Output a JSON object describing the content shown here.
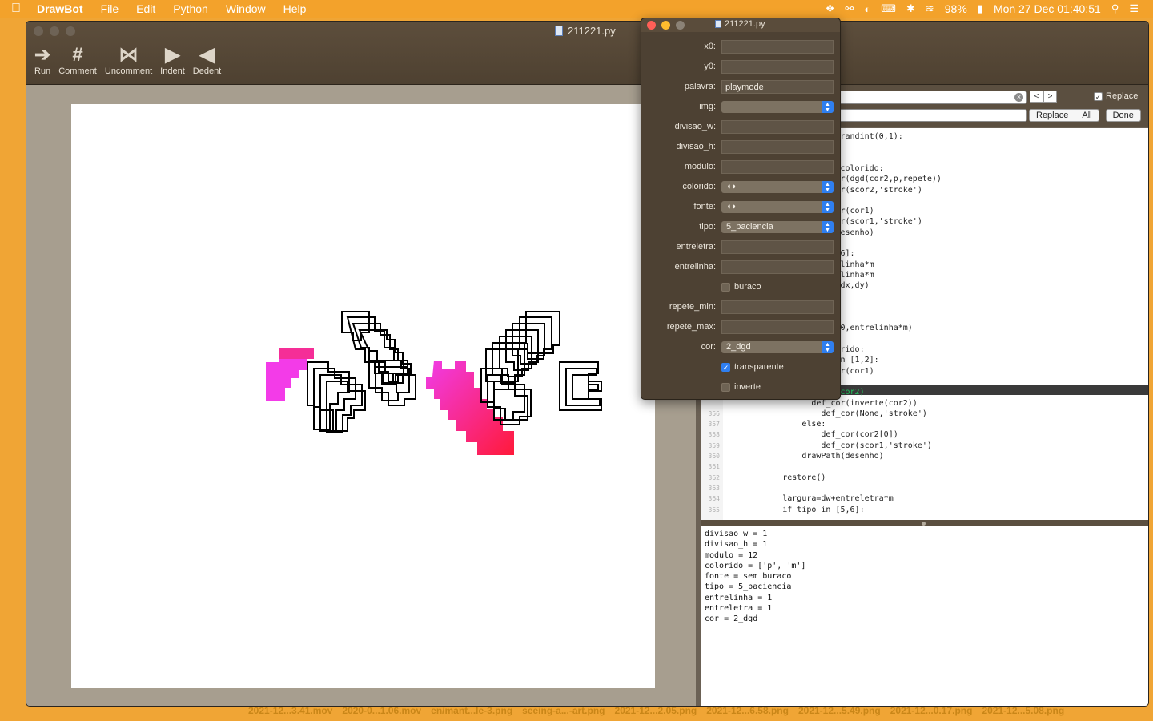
{
  "menubar": {
    "app_name": "DrawBot",
    "items": [
      "File",
      "Edit",
      "Python",
      "Window",
      "Help"
    ],
    "battery": "98%",
    "clock": "Mon 27 Dec  01:40:51"
  },
  "window": {
    "title": "211221.py",
    "toolbar": {
      "run": "Run",
      "comment": "Comment",
      "uncomment": "Uncomment",
      "indent": "Indent",
      "dedent": "Dedent"
    }
  },
  "find": {
    "replace_label": "Replace",
    "replace_checked": true,
    "replace_button": "Replace",
    "all_button": "All",
    "done_button": "Done"
  },
  "code_lines": [
    {
      "n": "",
      "t": "o and randint(0,1):"
    },
    {
      "n": "",
      "t": ""
    },
    {
      "n": "",
      "t": ""
    },
    {
      "n": "",
      "t": "ar in colorido:"
    },
    {
      "n": "",
      "t": "def_cor(dgd(cor2,p,repete))"
    },
    {
      "n": "",
      "t": "def_cor(scor2,'stroke')"
    },
    {
      "n": "",
      "t": ":"
    },
    {
      "n": "",
      "t": "def_cor(cor1)"
    },
    {
      "n": "",
      "t": "def_cor(scor1,'stroke')"
    },
    {
      "n": "",
      "t": "Path(desenho)"
    },
    {
      "n": "",
      "t": ""
    },
    {
      "n": "",
      "t": "in [5,6]:"
    },
    {
      "n": "",
      "t": "*entrelinha*m"
    },
    {
      "n": "",
      "t": "*entrelinha*m"
    },
    {
      "n": "",
      "t": "slate(dx,dy)"
    },
    {
      "n": "",
      "t": "dx"
    },
    {
      "n": "",
      "t": "dy"
    },
    {
      "n": "",
      "t": ""
    },
    {
      "n": "",
      "t": "slate(0,entrelinha*m)"
    },
    {
      "n": "",
      "t": ""
    },
    {
      "n": "",
      "t": "n colorido:"
    },
    {
      "n": "",
      "t": "tipo in [1,2]:"
    },
    {
      "n": "",
      "t": "def_cor(cor1)"
    },
    {
      "n": "",
      "t": ":"
    },
    {
      "n": "",
      "t": "print(cor2)"
    },
    {
      "n": "",
      "t": "def_cor(inverte(cor2))"
    },
    {
      "n": "356",
      "t": "                    def_cor(None,'stroke')"
    },
    {
      "n": "357",
      "t": "                else:"
    },
    {
      "n": "358",
      "t": "                    def_cor(cor2[0])"
    },
    {
      "n": "359",
      "t": "                    def_cor(scor1,'stroke')"
    },
    {
      "n": "360",
      "t": "                drawPath(desenho)"
    },
    {
      "n": "361",
      "t": ""
    },
    {
      "n": "362",
      "t": "            restore()"
    },
    {
      "n": "363",
      "t": ""
    },
    {
      "n": "364",
      "t": "            largura=dw+entreletra*m"
    },
    {
      "n": "365",
      "t": "            if tipo in [5,6]:"
    }
  ],
  "output_lines": [
    "divisao_w = 1",
    "divisao_h = 1",
    "modulo = 12",
    "colorido = ['p', 'm']",
    "fonte = sem buraco",
    "tipo = 5_paciencia",
    "entrelinha = 1",
    "entreletra = 1",
    "cor = 2_dgd"
  ],
  "panel": {
    "title": "211221.py",
    "x0": "x0:",
    "y0": "y0:",
    "palavra": "palavra:",
    "palavra_value": "playmode",
    "img": "img:",
    "divisao_w": "divisao_w:",
    "divisao_h": "divisao_h:",
    "modulo": "modulo:",
    "colorido": "colorido:",
    "colorido_value": "◖◗",
    "fonte": "fonte:",
    "fonte_value": "◖◗",
    "tipo": "tipo:",
    "tipo_value": "5_paciencia",
    "entreletra": "entreletra:",
    "entrelinha": "entrelinha:",
    "buraco": "buraco",
    "buraco_checked": false,
    "repete_min": "repete_min:",
    "repete_max": "repete_max:",
    "cor": "cor:",
    "cor_value": "2_dgd",
    "transparente": "transparente",
    "transparente_checked": true,
    "inverte": "inverte",
    "inverte_checked": false
  },
  "file_strip": [
    "2021-12...3.41.mov",
    "2020-0...1.06.mov",
    "en/mant...le-3.png",
    "seeing-a...-art.png",
    "2021-12...2.05.png",
    "2021-12...6.58.png",
    "2021-12...5.49.png",
    "2021-12...0.17.png",
    "2021-12...5.08.png"
  ],
  "colors": {
    "desktop": "#f0a535",
    "accent_blue": "#2f7ff0",
    "magenta": "#f03ce8",
    "red": "#ff1a3a"
  }
}
